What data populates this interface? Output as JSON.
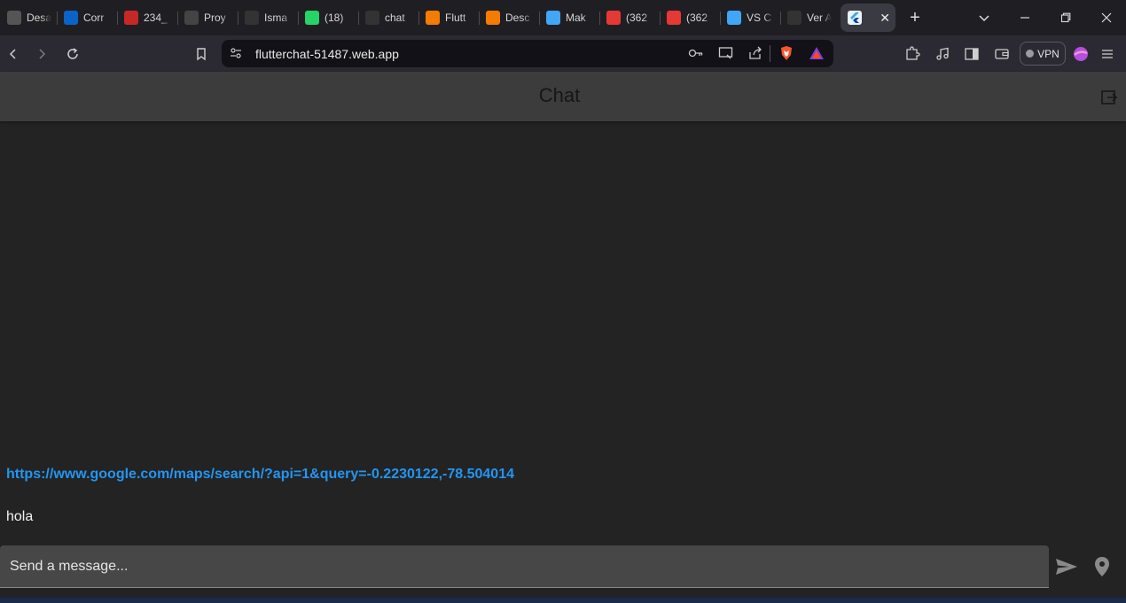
{
  "browser": {
    "tabs": [
      {
        "label": "Desa",
        "icon": "grid-logo-icon",
        "color": "#555555"
      },
      {
        "label": "Corr",
        "icon": "outlook-icon",
        "color": "#0a64c8"
      },
      {
        "label": "234_",
        "icon": "app-icon",
        "color": "#c62828"
      },
      {
        "label": "Proy",
        "icon": "chatgpt-icon",
        "color": "#444444"
      },
      {
        "label": "Isma",
        "icon": "github-icon",
        "color": "#333333"
      },
      {
        "label": "(18)",
        "icon": "whatsapp-icon",
        "color": "#25d366"
      },
      {
        "label": "chat",
        "icon": "github-icon",
        "color": "#333333"
      },
      {
        "label": "Flutt",
        "icon": "firebase-icon",
        "color": "#f57c00"
      },
      {
        "label": "Desc",
        "icon": "firebase-icon",
        "color": "#f57c00"
      },
      {
        "label": "Mak",
        "icon": "flutter-icon",
        "color": "#42a5f5"
      },
      {
        "label": "(362",
        "icon": "youtube-icon",
        "color": "#e53935"
      },
      {
        "label": "(362",
        "icon": "youtube-icon",
        "color": "#e53935"
      },
      {
        "label": "VS C",
        "icon": "flutter-icon",
        "color": "#42a5f5"
      },
      {
        "label": "Ver A",
        "icon": "af-icon",
        "color": "#333333"
      }
    ],
    "active_tab_label": "",
    "url": "flutterchat-51487.web.app",
    "vpn_label": "VPN"
  },
  "app": {
    "title": "Chat",
    "messages": [
      {
        "type": "link",
        "text": "https://www.google.com/maps/search/?api=1&query=-0.2230122,-78.504014"
      },
      {
        "type": "text",
        "text": "hola"
      }
    ],
    "composer_placeholder": "Send a message..."
  },
  "colors": {
    "link": "#2196f3",
    "appbar": "#3c3c3c",
    "background": "#232323"
  }
}
